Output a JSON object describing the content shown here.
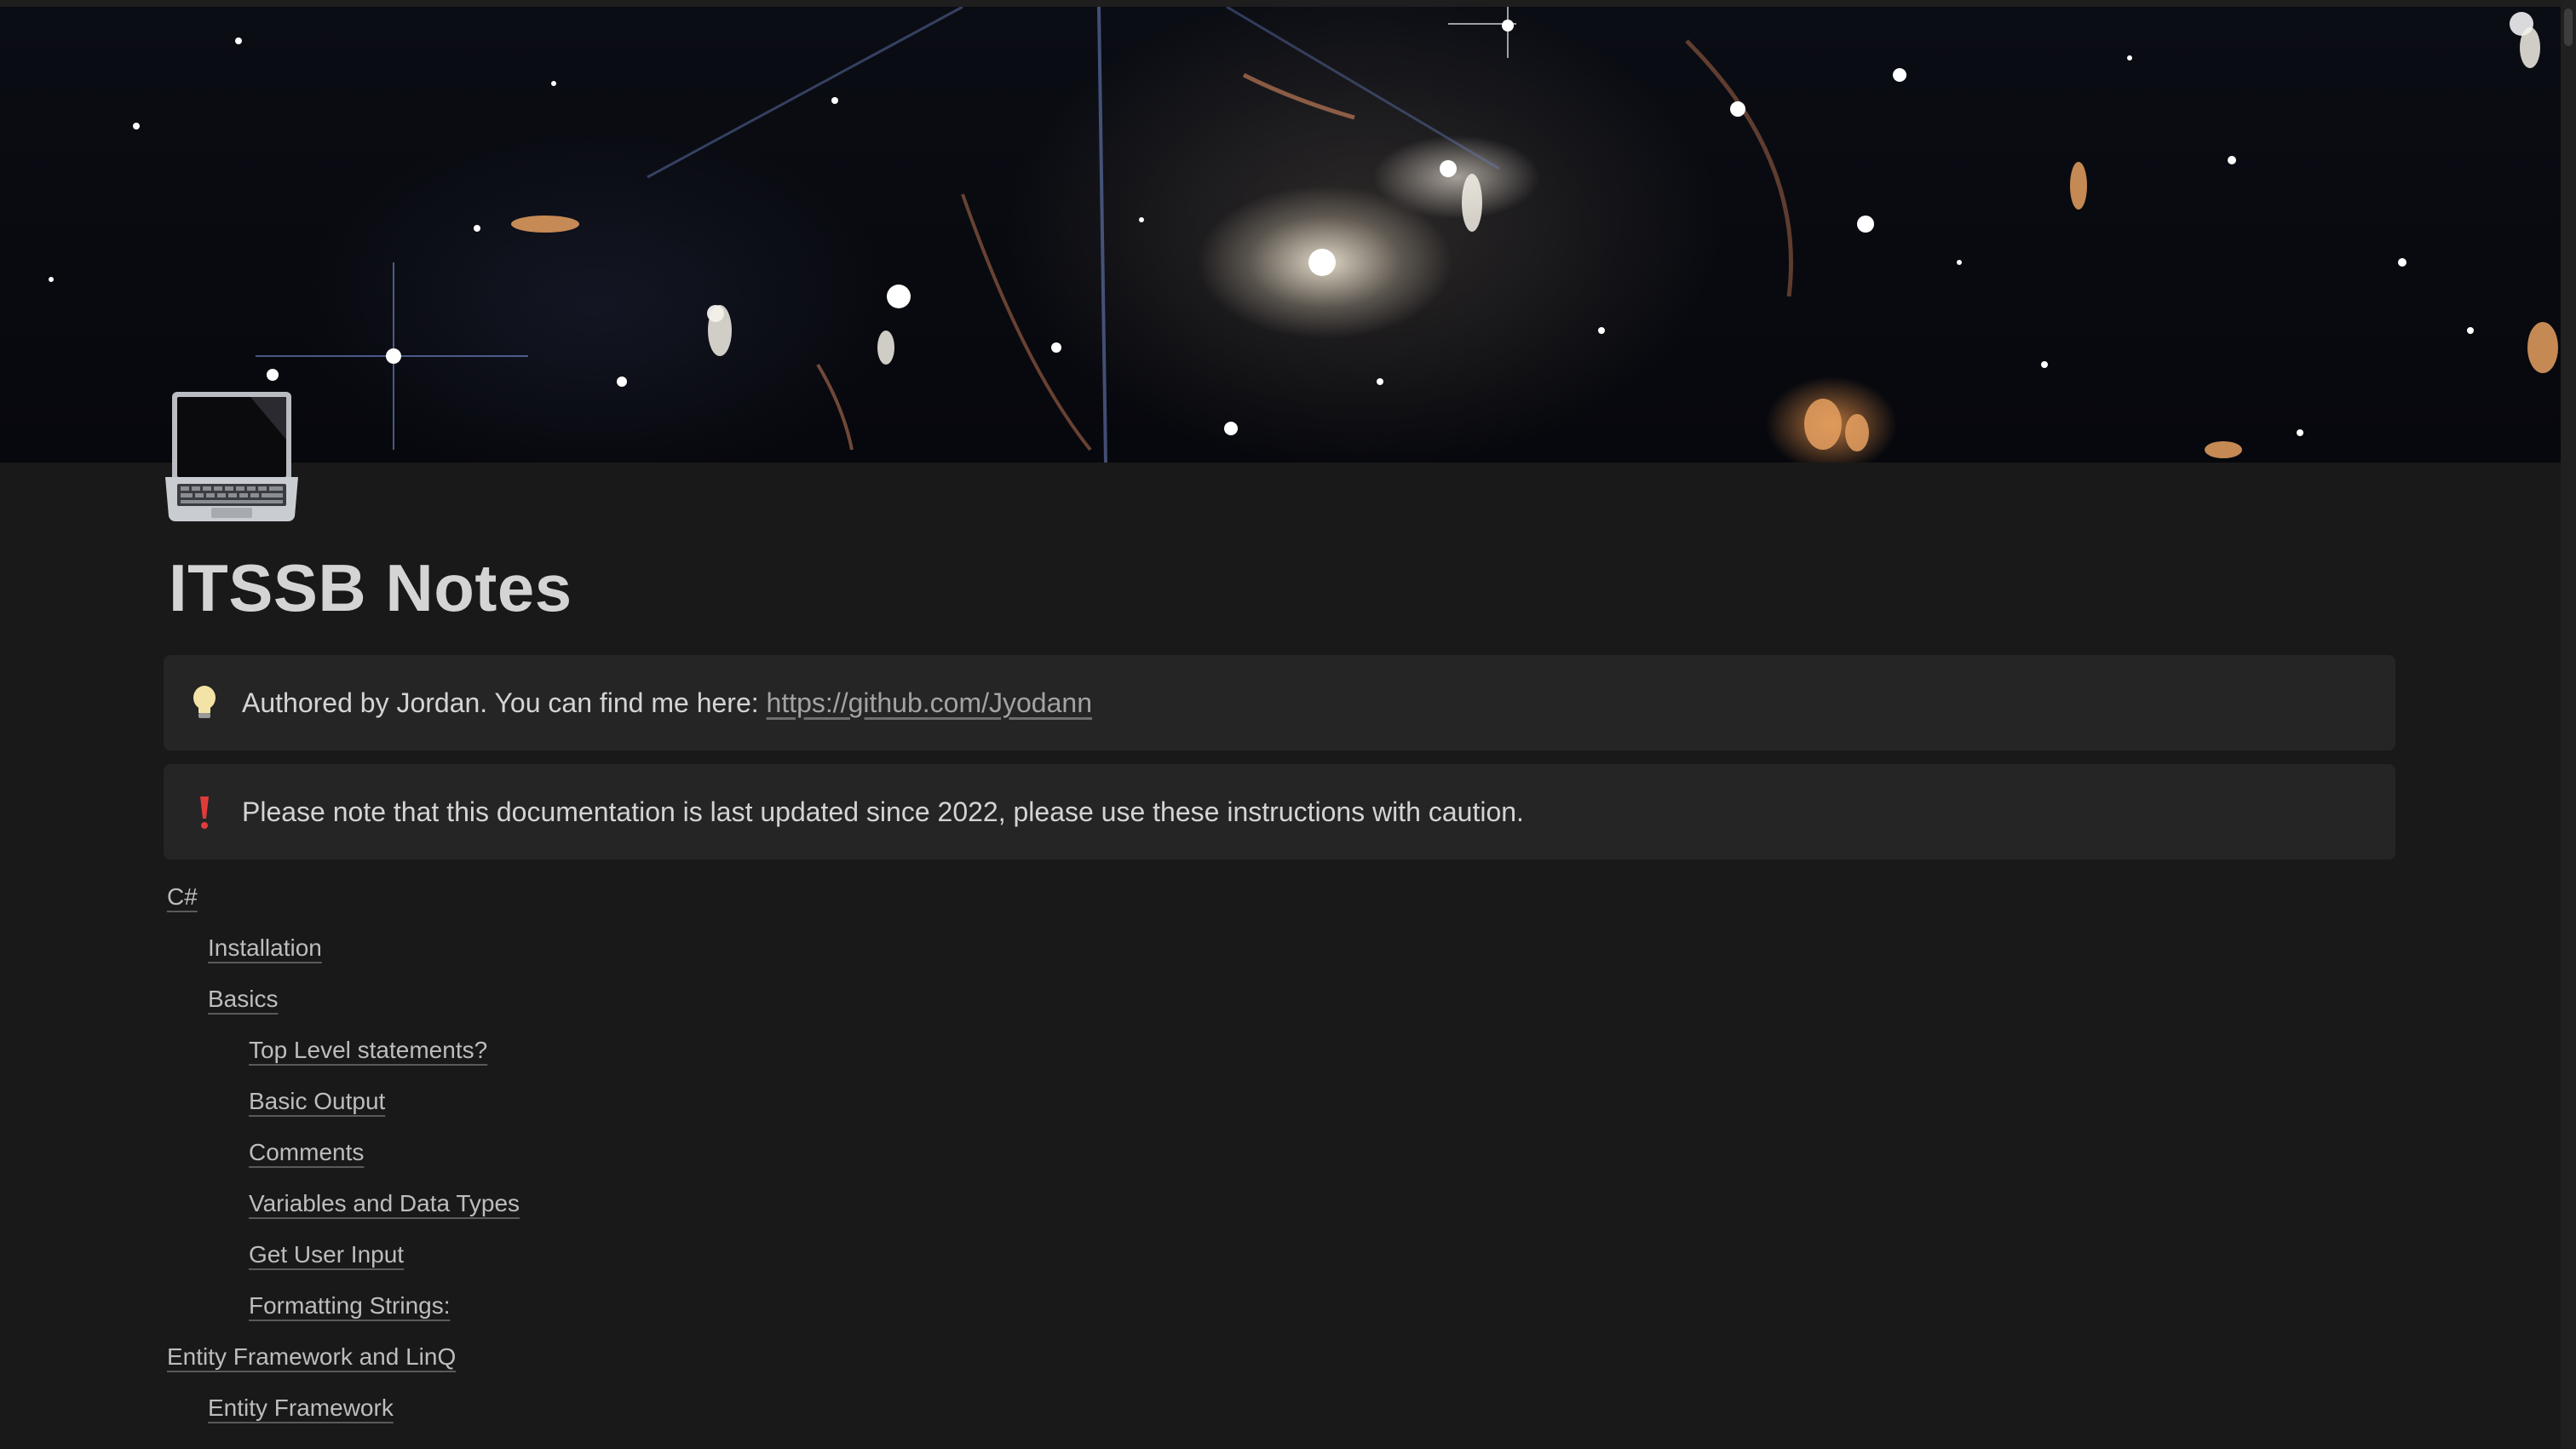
{
  "cover": {
    "image": "deep-field-galaxy-cluster-cover"
  },
  "page_icon": "laptop-icon",
  "title": "ITSSB Notes",
  "callouts": [
    {
      "icon": "lightbulb-icon",
      "text": "Authored by Jordan. You can find me here: ",
      "link": "https://github.com/Jyodann"
    },
    {
      "icon": "exclamation-icon",
      "text": "Please note that this documentation is last updated since 2022, please use these instructions with caution.",
      "link": ""
    }
  ],
  "toc": [
    {
      "label": "C#",
      "level": 0
    },
    {
      "label": "Installation",
      "level": 1
    },
    {
      "label": "Basics",
      "level": 1
    },
    {
      "label": "Top Level statements?",
      "level": 2
    },
    {
      "label": "Basic Output",
      "level": 2
    },
    {
      "label": "Comments",
      "level": 2
    },
    {
      "label": "Variables and Data Types",
      "level": 2
    },
    {
      "label": "Get User Input",
      "level": 2
    },
    {
      "label": "Formatting Strings:",
      "level": 2
    },
    {
      "label": "Entity Framework and LinQ",
      "level": 0
    },
    {
      "label": "Entity Framework",
      "level": 1
    }
  ],
  "colors": {
    "background": "#191919",
    "callout_bg": "#252525",
    "text": "#d4d4d4",
    "alert": "#e03b3b"
  }
}
